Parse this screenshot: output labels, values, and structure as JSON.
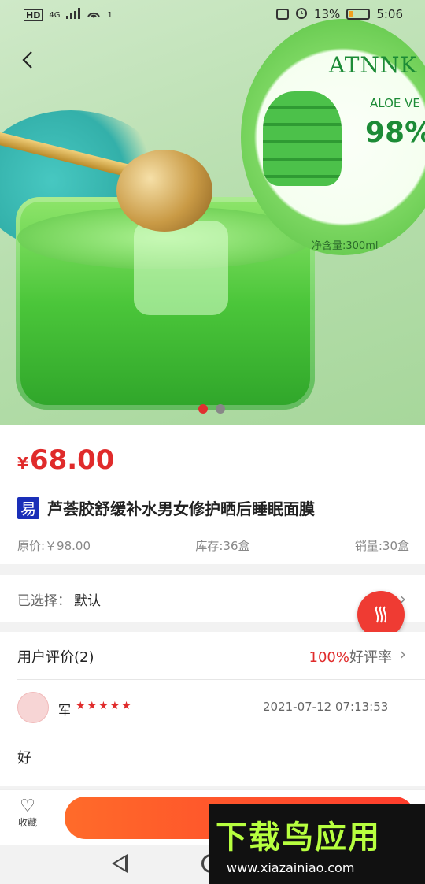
{
  "status_bar": {
    "left_indicators": [
      "HD",
      "4G",
      "1"
    ],
    "battery": "13%",
    "time": "5:06"
  },
  "product_image": {
    "brand": "ATNNK",
    "percent": "98%",
    "aloe": "ALOE VE",
    "volume": "净含量:300ml",
    "carousel_active": 1,
    "carousel_count": 2
  },
  "product": {
    "currency": "¥",
    "price": "68.00",
    "badge": "易",
    "title": "芦荟胶舒缓补水男女修护晒后睡眠面膜",
    "original_price": "原价:￥98.00",
    "stock": "库存:36盒",
    "sales": "销量:30盒"
  },
  "selection": {
    "label": "已选择：",
    "value": "默认"
  },
  "reviews": {
    "title": "用户评价(2)",
    "rate_pct": "100%",
    "rate_label": "好评率",
    "items": [
      {
        "name": "军",
        "stars": "★★★★★",
        "date": "2021-07-12 07:13:53",
        "text": "好"
      }
    ]
  },
  "bottom_bar": {
    "favorite_label": "收藏"
  },
  "watermark": {
    "title": "下载鸟应用",
    "url": "www.xiazainiao.com"
  },
  "colors": {
    "accent_red": "#e02b2b",
    "buy_gradient_start": "#ff6b2a",
    "buy_gradient_end": "#ff3c2c"
  }
}
